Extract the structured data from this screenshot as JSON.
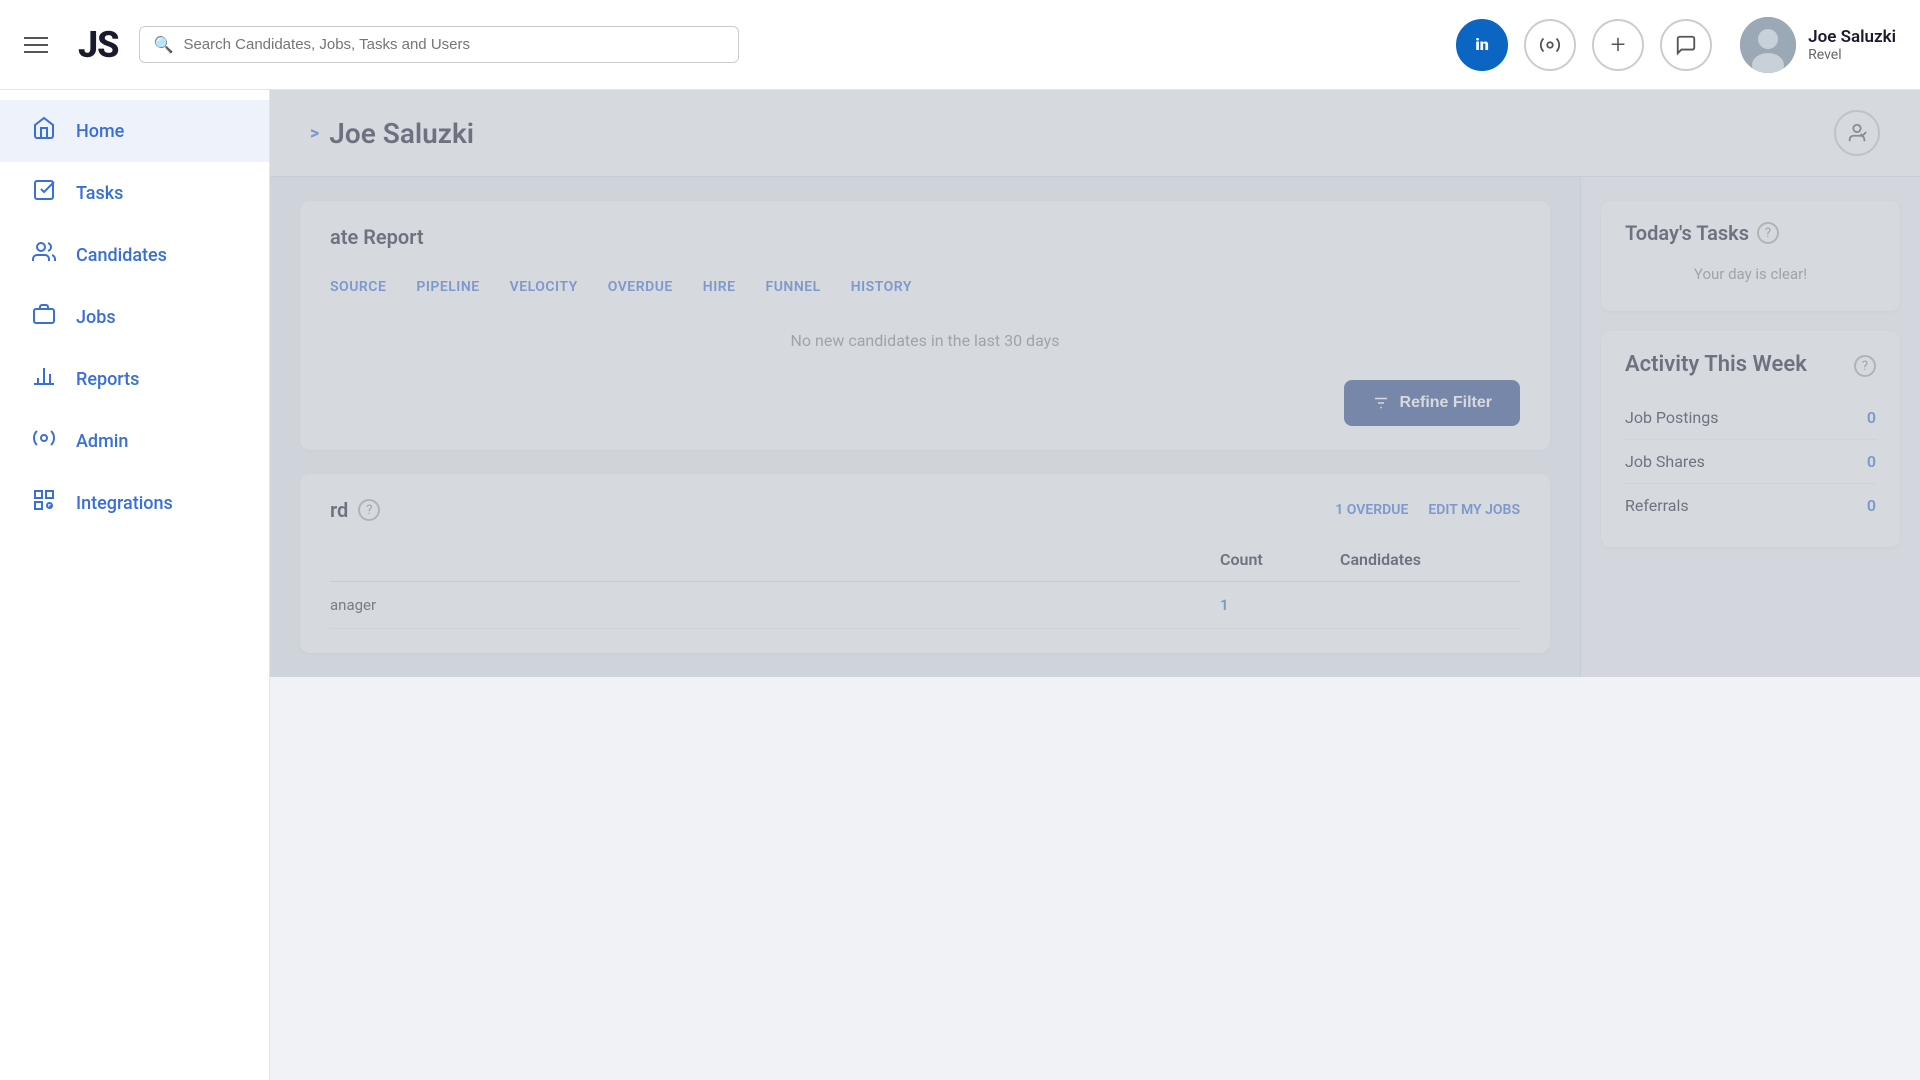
{
  "app": {
    "logo": "JS"
  },
  "topnav": {
    "search_placeholder": "Search Candidates, Jobs, Tasks and Users",
    "linkedin_label": "in",
    "tool1_icon": "🔧",
    "tool2_icon": "+",
    "messages_icon": "💬",
    "user_name": "Joe Saluzki",
    "user_org": "Revel"
  },
  "sidebar": {
    "items": [
      {
        "id": "home",
        "label": "Home",
        "icon": "⌂"
      },
      {
        "id": "tasks",
        "label": "Tasks",
        "icon": "☑"
      },
      {
        "id": "candidates",
        "label": "Candidates",
        "icon": "👥"
      },
      {
        "id": "jobs",
        "label": "Jobs",
        "icon": "💼"
      },
      {
        "id": "reports",
        "label": "Reports",
        "icon": "📊"
      },
      {
        "id": "admin",
        "label": "Admin",
        "icon": "⚙"
      },
      {
        "id": "integrations",
        "label": "Integrations",
        "icon": "⊞"
      }
    ]
  },
  "page": {
    "breadcrumb_arrow": ">",
    "title": "Joe Saluzki"
  },
  "report_section": {
    "title": "ate Report",
    "tabs": [
      "SOURCE",
      "PIPELINE",
      "VELOCITY",
      "OVERDUE",
      "HIRE",
      "FUNNEL",
      "HISTORY"
    ],
    "no_data": "No new candidates in the last 30 days",
    "refine_button": "Refine Filter"
  },
  "dashboard_section": {
    "title_partial": "rd",
    "help_icon": "?",
    "overdue_label": "1 OVERDUE",
    "edit_label": "EDIT MY JOBS",
    "columns": [
      "Count",
      "Candidates"
    ],
    "rows": [
      {
        "name": "anager",
        "count": "1",
        "candidates": ""
      }
    ]
  },
  "todays_tasks": {
    "title": "Today's Tasks",
    "help_icon": "?",
    "message": "Your day is clear!"
  },
  "activity": {
    "title": "Activity This Week",
    "help_icon": "?",
    "items": [
      {
        "label": "Job Postings",
        "count": "0"
      },
      {
        "label": "Job Shares",
        "count": "0"
      },
      {
        "label": "Referrals",
        "count": "0"
      }
    ]
  }
}
